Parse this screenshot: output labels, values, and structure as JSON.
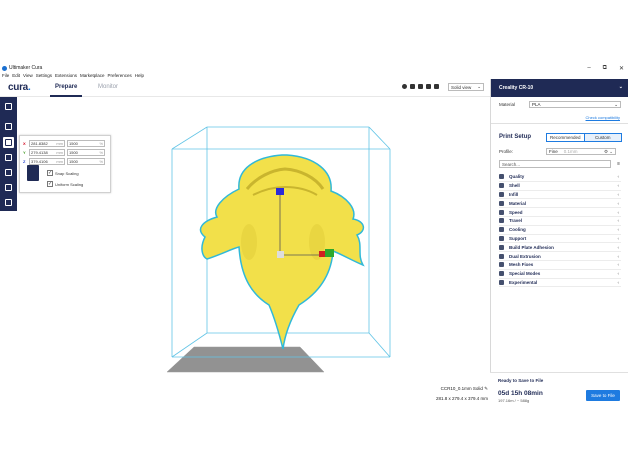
{
  "window": {
    "title": "Ultimaker Cura",
    "controls": [
      "–",
      "⧉",
      "✕"
    ]
  },
  "menu": [
    "File",
    "Edit",
    "View",
    "Settings",
    "Extensions",
    "Marketplace",
    "Preferences",
    "Help"
  ],
  "header": {
    "brand": "cura",
    "brand_dot": ".",
    "tabs": [
      {
        "label": "Prepare",
        "active": true
      },
      {
        "label": "Monitor",
        "active": false
      }
    ],
    "view_mode": "Solid view"
  },
  "scale_tool": {
    "x": {
      "axis": "X",
      "mm": "281.8382",
      "unit": "mm",
      "pct": "1500",
      "pct_unit": "%"
    },
    "y": {
      "axis": "Y",
      "mm": "279.4138",
      "unit": "mm",
      "pct": "1500",
      "pct_unit": "%"
    },
    "z": {
      "axis": "Z",
      "mm": "379.4106",
      "unit": "mm",
      "pct": "1500",
      "pct_unit": "%"
    },
    "snap_scaling": "Snap Scaling",
    "uniform_scaling": "Uniform Scaling"
  },
  "model_info": {
    "name": "CCR10_0.1mm Solid",
    "dimensions": "281.8 x 279.4 x 379.4 mm"
  },
  "right_panel": {
    "printer": "Creality CR-10",
    "material_label": "Material",
    "material_value": "PLA",
    "compat_link": "Check compatibility",
    "print_setup": "Print Setup",
    "modes": [
      "Recommended",
      "Custom"
    ],
    "profile_label": "Profile:",
    "profile_value": "Fine",
    "profile_sub": "0.1mm",
    "search_placeholder": "Search...",
    "categories": [
      "Quality",
      "Shell",
      "Infill",
      "Material",
      "Speed",
      "Travel",
      "Cooling",
      "Support",
      "Build Plate Adhesion",
      "Dual Extrusion",
      "Mesh Fixes",
      "Special Modes",
      "Experimental"
    ]
  },
  "output": {
    "status": "Ready to Save to File",
    "time": "05d 15h 08min",
    "usage": "197.16m / ~ 588g",
    "save_label": "Save to File"
  },
  "colors": {
    "accent": "#1e7be0",
    "navy": "#1f2a55",
    "model": "#f2e04a",
    "model_outline": "#31b9d8"
  }
}
